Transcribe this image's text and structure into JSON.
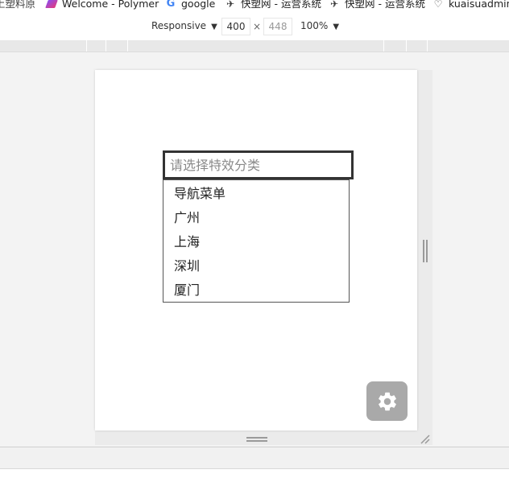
{
  "bookmarks": {
    "cut_label": "上塑料原",
    "polymer": {
      "label": "Welcome - Polymer",
      "icon": "polymer-icon"
    },
    "google": {
      "label": "google",
      "icon": "google-icon"
    },
    "kuai1": {
      "label": "快塑网 - 运营系统",
      "icon": "kuai-icon"
    },
    "kuai2": {
      "label": "快塑网 - 运营系统",
      "icon": "kuai-icon"
    },
    "kuaiadmin": {
      "label": "kuaisuadmin/",
      "icon": "heart-icon"
    }
  },
  "device_toolbar": {
    "mode": "Responsive",
    "arrow": "▼",
    "width": "400",
    "times": "×",
    "height": "448",
    "zoom": "100%",
    "zoom_arrow": "▼"
  },
  "select": {
    "placeholder": "请选择特效分类",
    "value": ""
  },
  "dropdown": {
    "options": [
      "导航菜单",
      "广州",
      "上海",
      "深圳",
      "厦门"
    ]
  },
  "gear_button": {
    "icon": "gear-icon",
    "color": "#a9a9a9"
  }
}
